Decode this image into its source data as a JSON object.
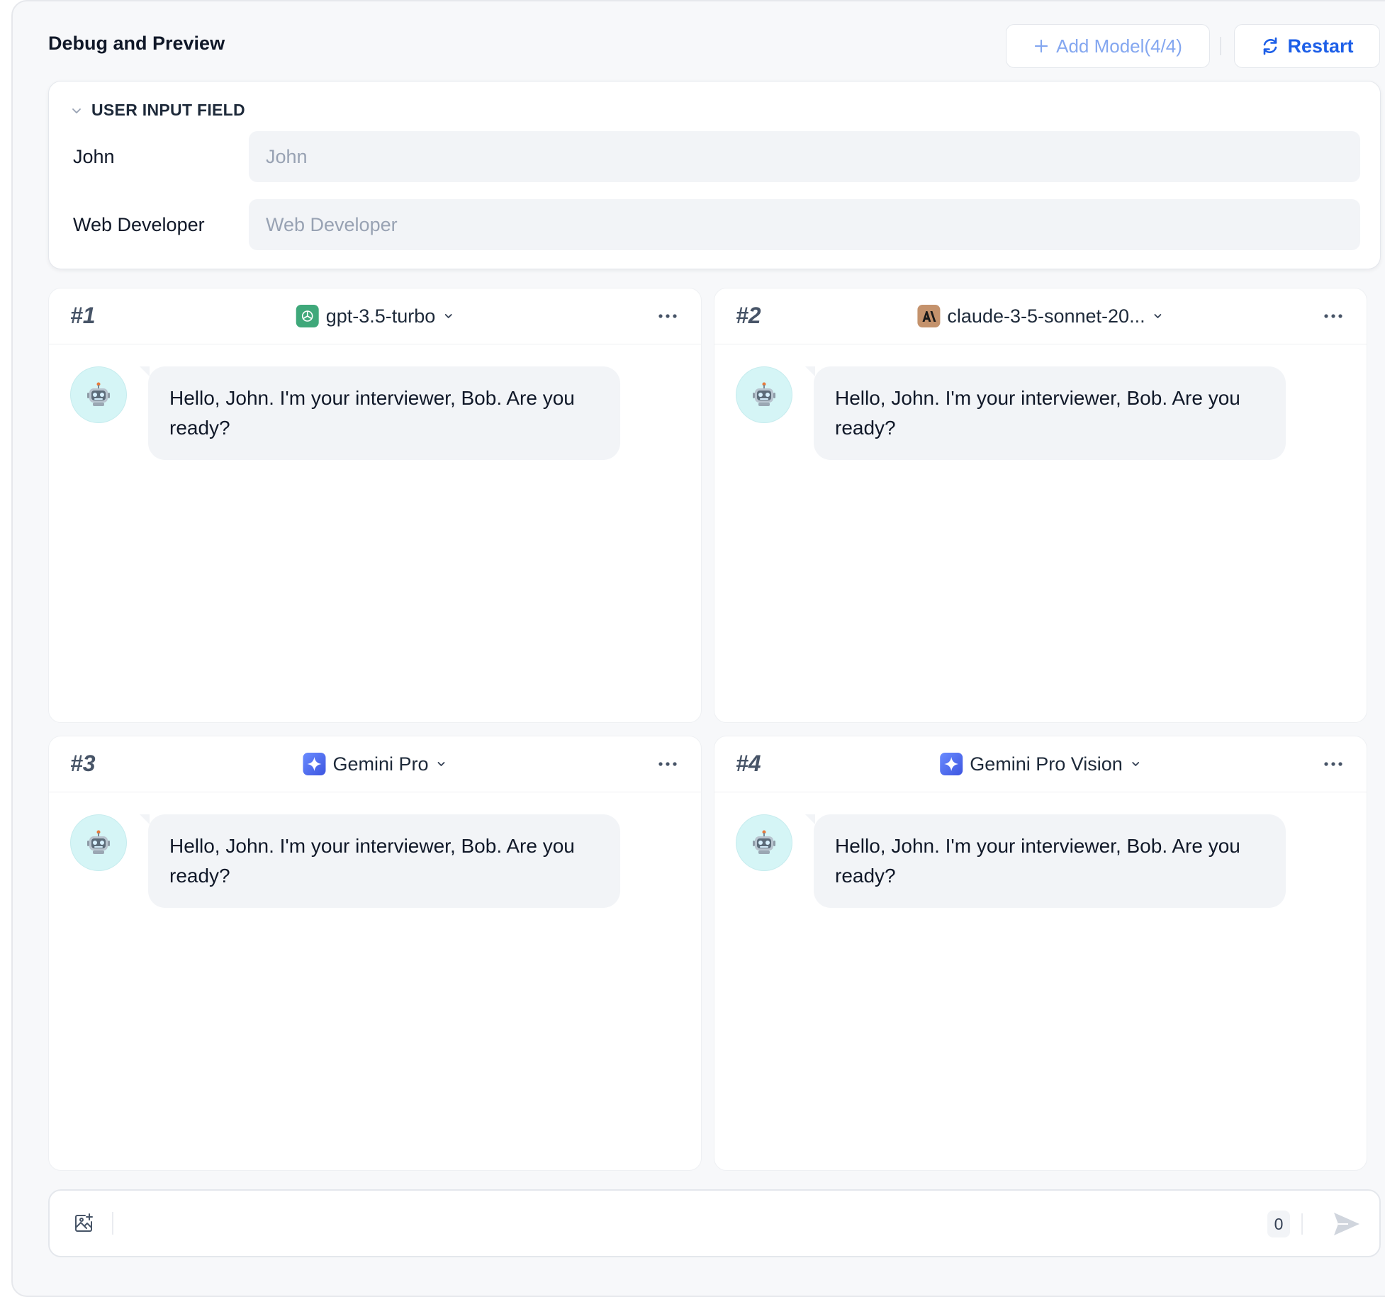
{
  "header": {
    "title": "Debug and Preview",
    "add_model_label": "Add Model(4/4)",
    "restart_label": "Restart"
  },
  "user_input": {
    "section_title": "USER INPUT FIELD",
    "fields": [
      {
        "label": "John",
        "placeholder": "John",
        "value": ""
      },
      {
        "label": "Web Developer",
        "placeholder": "Web Developer",
        "value": ""
      }
    ]
  },
  "panels": [
    {
      "number": "#1",
      "model": "gpt-3.5-turbo",
      "icon": "openai-icon",
      "icon_color": "#3fa87a",
      "message": "Hello, John. I'm your interviewer, Bob. Are you ready?"
    },
    {
      "number": "#2",
      "model": "claude-3-5-sonnet-20...",
      "icon": "anthropic-icon",
      "icon_color": "#c4926c",
      "message": "Hello, John. I'm your interviewer, Bob. Are you ready?"
    },
    {
      "number": "#3",
      "model": "Gemini Pro",
      "icon": "gemini-icon",
      "icon_color": "#4f6ef0",
      "message": "Hello, John. I'm your interviewer, Bob. Are you ready?"
    },
    {
      "number": "#4",
      "model": "Gemini Pro Vision",
      "icon": "gemini-icon",
      "icon_color": "#4f6ef0",
      "message": "Hello, John. I'm your interviewer, Bob. Are you ready?"
    }
  ],
  "composer": {
    "value": "",
    "char_count": "0"
  },
  "colors": {
    "accent": "#1d5fe8",
    "accent_muted": "#84a7f0",
    "avatar_bg": "#d5f5f6"
  }
}
